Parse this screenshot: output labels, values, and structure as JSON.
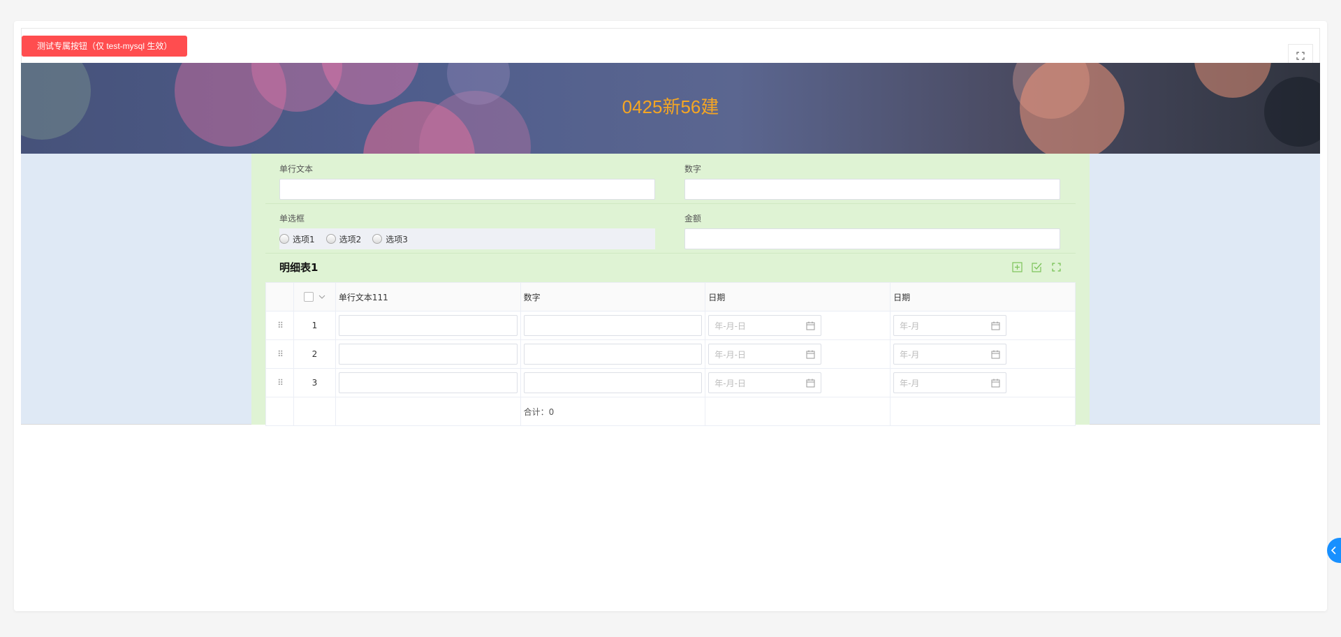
{
  "toolbar": {
    "test_button_label": "测试专属按钮（仅 test-mysql 生效）"
  },
  "banner": {
    "title": "0425新56建"
  },
  "form": {
    "single_text_label": "单行文本",
    "number_label": "数字",
    "radio_label": "单选框",
    "radio_options": [
      "选项1",
      "选项2",
      "选项3"
    ],
    "amount_label": "金额"
  },
  "detail_table": {
    "title": "明细表1",
    "columns": [
      "单行文本111",
      "数字",
      "日期",
      "日期"
    ],
    "rows": [
      {
        "index": "1",
        "date_placeholder": "年-月-日",
        "month_placeholder": "年-月"
      },
      {
        "index": "2",
        "date_placeholder": "年-月-日",
        "month_placeholder": "年-月"
      },
      {
        "index": "3",
        "date_placeholder": "年-月-日",
        "month_placeholder": "年-月"
      }
    ],
    "sum_label": "合计：",
    "sum_value": "0"
  },
  "colors": {
    "accent_red": "#ff4d4f",
    "banner_title": "#f5a623",
    "form_green": "#dff3d4",
    "form_blue": "#dfe9f5",
    "icon_green": "#7cc35a",
    "side_tab_blue": "#1890ff"
  },
  "icons": [
    "fullscreen-icon",
    "add-row-icon",
    "batch-edit-icon",
    "expand-icon",
    "calendar-icon",
    "drag-handle-icon",
    "chevron-down-icon",
    "chevron-left-icon"
  ]
}
